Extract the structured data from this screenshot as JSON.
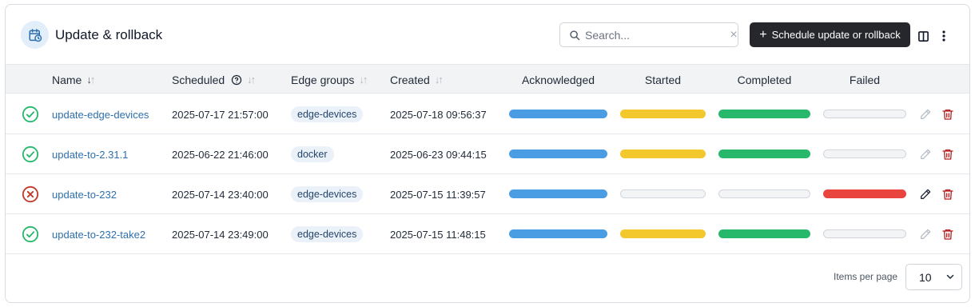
{
  "header": {
    "title": "Update & rollback",
    "title_icon": "calendar-clock-icon",
    "search_placeholder": "Search...",
    "search_value": "",
    "primary_button_label": "Schedule update or rollback"
  },
  "columns": {
    "name": "Name",
    "scheduled": "Scheduled",
    "edge_groups": "Edge groups",
    "created": "Created",
    "acknowledged": "Acknowledged",
    "started": "Started",
    "completed": "Completed",
    "failed": "Failed"
  },
  "colors": {
    "acknowledged": "#4a9de3",
    "started": "#f2c82c",
    "completed": "#27b86b",
    "failed": "#e9443e",
    "success_icon": "#27b86b",
    "error_icon": "#c0392b",
    "delete_icon": "#b91c1c"
  },
  "rows": [
    {
      "status": "success",
      "name": "update-edge-devices",
      "scheduled": "2025-07-17 21:57:00",
      "edge_group": "edge-devices",
      "created": "2025-07-18 09:56:37",
      "acknowledged": 1,
      "started": 1,
      "completed": 1,
      "failed": 0,
      "edit_enabled": false
    },
    {
      "status": "success",
      "name": "update-to-2.31.1",
      "scheduled": "2025-06-22 21:46:00",
      "edge_group": "docker",
      "created": "2025-06-23 09:44:15",
      "acknowledged": 1,
      "started": 1,
      "completed": 1,
      "failed": 0,
      "edit_enabled": false
    },
    {
      "status": "error",
      "name": "update-to-232",
      "scheduled": "2025-07-14 23:40:00",
      "edge_group": "edge-devices",
      "created": "2025-07-15 11:39:57",
      "acknowledged": 1,
      "started": 0,
      "completed": 0,
      "failed": 1,
      "edit_enabled": true
    },
    {
      "status": "success",
      "name": "update-to-232-take2",
      "scheduled": "2025-07-14 23:49:00",
      "edge_group": "edge-devices",
      "created": "2025-07-15 11:48:15",
      "acknowledged": 1,
      "started": 1,
      "completed": 1,
      "failed": 0,
      "edit_enabled": false
    }
  ],
  "footer": {
    "items_per_page_label": "Items per page",
    "items_per_page_value": "10"
  }
}
